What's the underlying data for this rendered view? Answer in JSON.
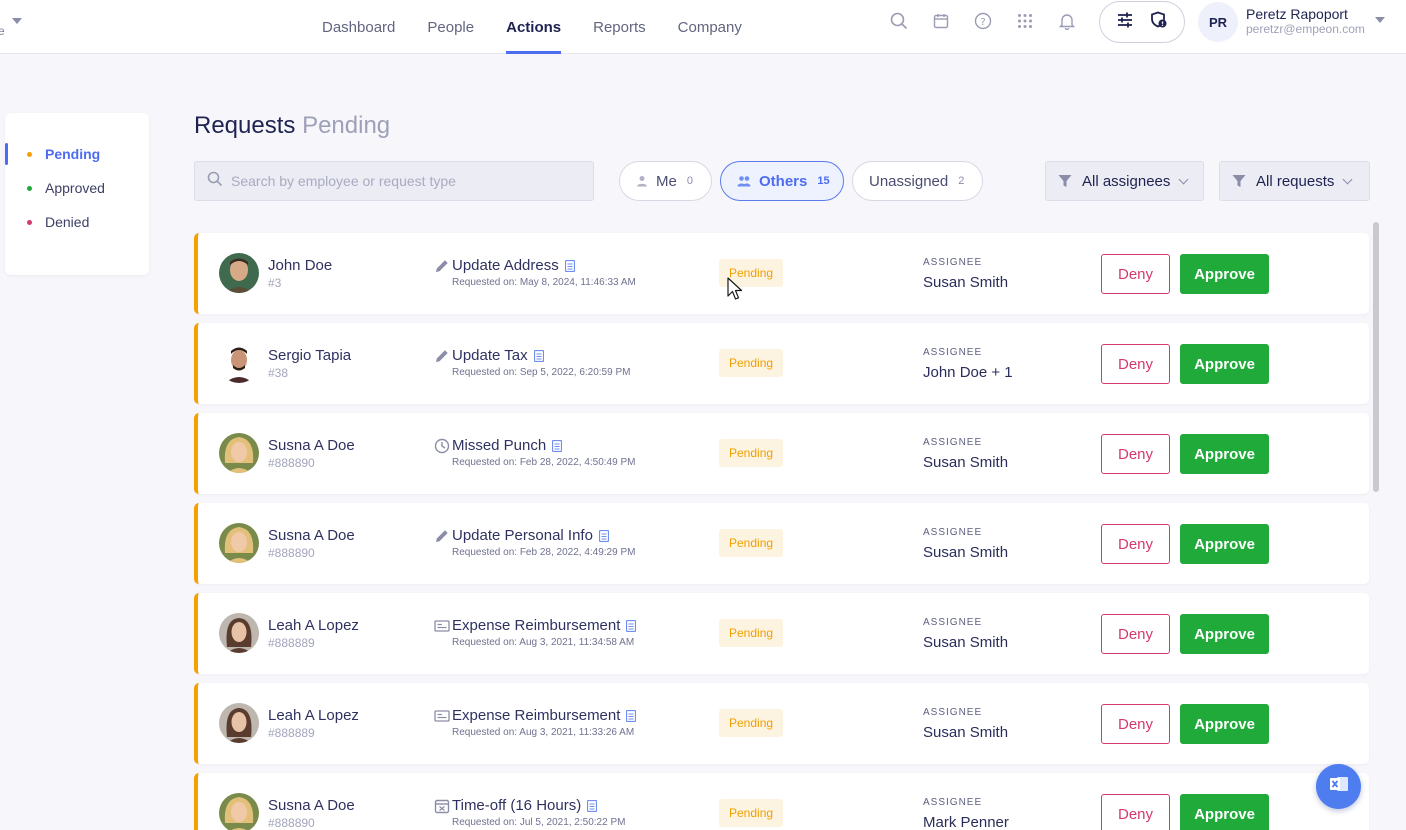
{
  "topbar": {
    "left_fragment": "e",
    "nav": [
      "Dashboard",
      "People",
      "Actions",
      "Reports",
      "Company"
    ],
    "active_nav": "Actions",
    "user": {
      "initials": "PR",
      "name": "Peretz Rapoport",
      "email": "peretzr@empeon.com"
    }
  },
  "sidebar": {
    "items": [
      {
        "label": "Pending",
        "color": "#f6a000",
        "active": true
      },
      {
        "label": "Approved",
        "color": "#1faa3a",
        "active": false
      },
      {
        "label": "Denied",
        "color": "#d43a6f",
        "active": false
      }
    ]
  },
  "heading": {
    "title": "Requests",
    "subtitle": "Pending"
  },
  "search": {
    "placeholder": "Search by employee or request type",
    "value": ""
  },
  "chips": [
    {
      "label": "Me",
      "count": "0",
      "active": false
    },
    {
      "label": "Others",
      "count": "15",
      "active": true
    },
    {
      "label": "Unassigned",
      "count": "2",
      "active": false
    }
  ],
  "filters": {
    "assignees": "All assignees",
    "requests": "All requests"
  },
  "labels": {
    "assignee": "ASSIGNEE",
    "deny": "Deny",
    "approve": "Approve"
  },
  "rows": [
    {
      "name": "John Doe",
      "id": "#3",
      "type": "Update Address",
      "icon": "pencil-icon",
      "date": "Requested on: May 8, 2024, 11:46:33 AM",
      "status": "Pending",
      "assignee": "Susan Smith"
    },
    {
      "name": "Sergio Tapia",
      "id": "#38",
      "type": "Update Tax",
      "icon": "pencil-icon",
      "date": "Requested on: Sep 5, 2022, 6:20:59 PM",
      "status": "Pending",
      "assignee": "John Doe + 1"
    },
    {
      "name": "Susna A Doe",
      "id": "#888890",
      "type": "Missed Punch",
      "icon": "clock-icon",
      "date": "Requested on: Feb 28, 2022, 4:50:49 PM",
      "status": "Pending",
      "assignee": "Susan Smith"
    },
    {
      "name": "Susna A Doe",
      "id": "#888890",
      "type": "Update Personal Info",
      "icon": "pencil-icon",
      "date": "Requested on: Feb 28, 2022, 4:49:29 PM",
      "status": "Pending",
      "assignee": "Susan Smith"
    },
    {
      "name": "Leah A Lopez",
      "id": "#888889",
      "type": "Expense Reimbursement",
      "icon": "receipt-icon",
      "date": "Requested on: Aug 3, 2021, 11:34:58 AM",
      "status": "Pending",
      "assignee": "Susan Smith"
    },
    {
      "name": "Leah A Lopez",
      "id": "#888889",
      "type": "Expense Reimbursement",
      "icon": "receipt-icon",
      "date": "Requested on: Aug 3, 2021, 11:33:26 AM",
      "status": "Pending",
      "assignee": "Susan Smith"
    },
    {
      "name": "Susna A Doe",
      "id": "#888890",
      "type": "Time-off (16 Hours)",
      "icon": "calendar-icon",
      "date": "Requested on: Jul 5, 2021, 2:50:22 PM",
      "status": "Pending",
      "assignee": "Mark Penner"
    }
  ],
  "colors": {
    "accent": "#4e6cf0",
    "pending": "#f6a000",
    "approve": "#1faa3a",
    "deny": "#d43a6f"
  }
}
